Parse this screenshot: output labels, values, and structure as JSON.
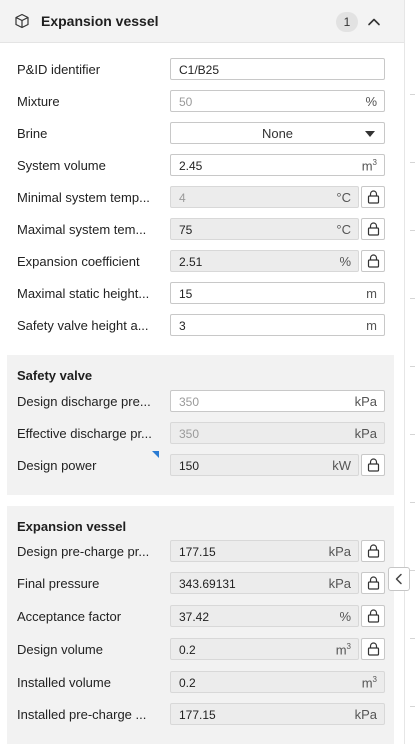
{
  "header": {
    "icon": "cube-icon",
    "title": "Expansion vessel",
    "count": "1"
  },
  "general": {
    "rows": [
      {
        "label": "P&ID identifier",
        "value": "C1/B25",
        "unit": "",
        "placeholder": false,
        "disabled": false,
        "lock": false
      },
      {
        "label": "Mixture",
        "value": "50",
        "unit": "%",
        "placeholder": true,
        "disabled": false,
        "lock": false
      },
      {
        "label": "Brine",
        "value": "None",
        "type": "select"
      },
      {
        "label": "System volume",
        "value": "2.45",
        "unit": "m",
        "unit_sup": "3",
        "placeholder": false,
        "disabled": false,
        "lock": false
      },
      {
        "label": "Minimal system temp...",
        "value": "4",
        "unit": "°C",
        "placeholder": true,
        "disabled": true,
        "lock": true
      },
      {
        "label": "Maximal system tem...",
        "value": "75",
        "unit": "°C",
        "placeholder": false,
        "disabled": true,
        "lock": true
      },
      {
        "label": "Expansion coefficient",
        "value": "2.51",
        "unit": "%",
        "placeholder": false,
        "disabled": true,
        "lock": true
      },
      {
        "label": "Maximal static height...",
        "value": "15",
        "unit": "m",
        "placeholder": false,
        "disabled": false,
        "lock": false
      },
      {
        "label": "Safety valve height a...",
        "value": "3",
        "unit": "m",
        "placeholder": false,
        "disabled": false,
        "lock": false
      }
    ]
  },
  "safety_valve": {
    "title": "Safety valve",
    "rows": [
      {
        "label": "Design discharge pre...",
        "value": "350",
        "unit": "kPa",
        "placeholder": true,
        "disabled": false,
        "lock": false
      },
      {
        "label": "Effective discharge pr...",
        "value": "350",
        "unit": "kPa",
        "placeholder": true,
        "disabled": true,
        "lock": false
      },
      {
        "label": "Design power",
        "value": "150",
        "unit": "kW",
        "placeholder": false,
        "disabled": true,
        "lock": true
      }
    ]
  },
  "expansion_vessel": {
    "title": "Expansion vessel",
    "rows": [
      {
        "label": "Design pre-charge pr...",
        "value": "177.15",
        "unit": "kPa",
        "placeholder": false,
        "disabled": true,
        "lock": true
      },
      {
        "label": "Final pressure",
        "value": "343.69131",
        "unit": "kPa",
        "placeholder": false,
        "disabled": true,
        "lock": true
      },
      {
        "label": "Acceptance factor",
        "value": "37.42",
        "unit": "%",
        "placeholder": false,
        "disabled": true,
        "lock": true
      },
      {
        "label": "Design volume",
        "value": "0.2",
        "unit": "m",
        "unit_sup": "3",
        "placeholder": false,
        "disabled": true,
        "lock": true
      },
      {
        "label": "Installed volume",
        "value": "0.2",
        "unit": "m",
        "unit_sup": "3",
        "placeholder": false,
        "disabled": true,
        "lock": false
      },
      {
        "label": "Installed pre-charge ...",
        "value": "177.15",
        "unit": "kPa",
        "placeholder": false,
        "disabled": true,
        "lock": false
      }
    ]
  },
  "colors": {
    "header_bg": "#f3f3f3",
    "section_bg": "#f2f2f2",
    "disabled_field_bg": "#ececec",
    "accent_marker": "#2b7cd3"
  }
}
